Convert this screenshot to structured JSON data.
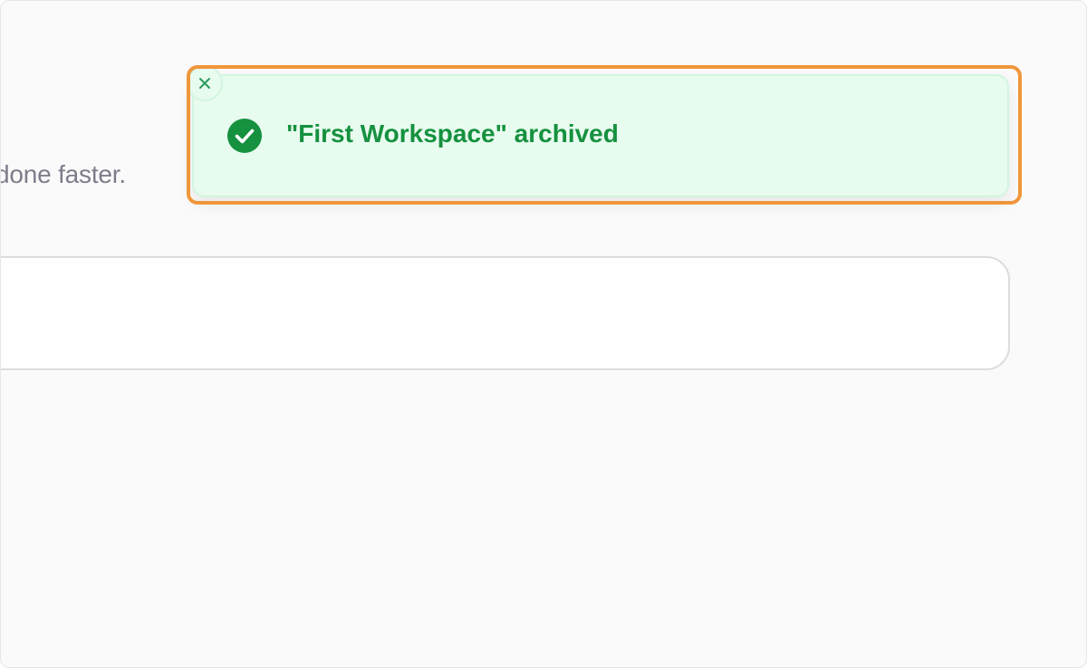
{
  "background": {
    "subtitle_fragment": "done faster."
  },
  "toast": {
    "message": "\"First Workspace\" archived",
    "status": "success",
    "icon": "check-circle-icon",
    "close_icon": "close-icon",
    "accent_color": "#15913f",
    "background_color": "#e8fbef"
  },
  "highlight": {
    "color": "#f0963a"
  }
}
